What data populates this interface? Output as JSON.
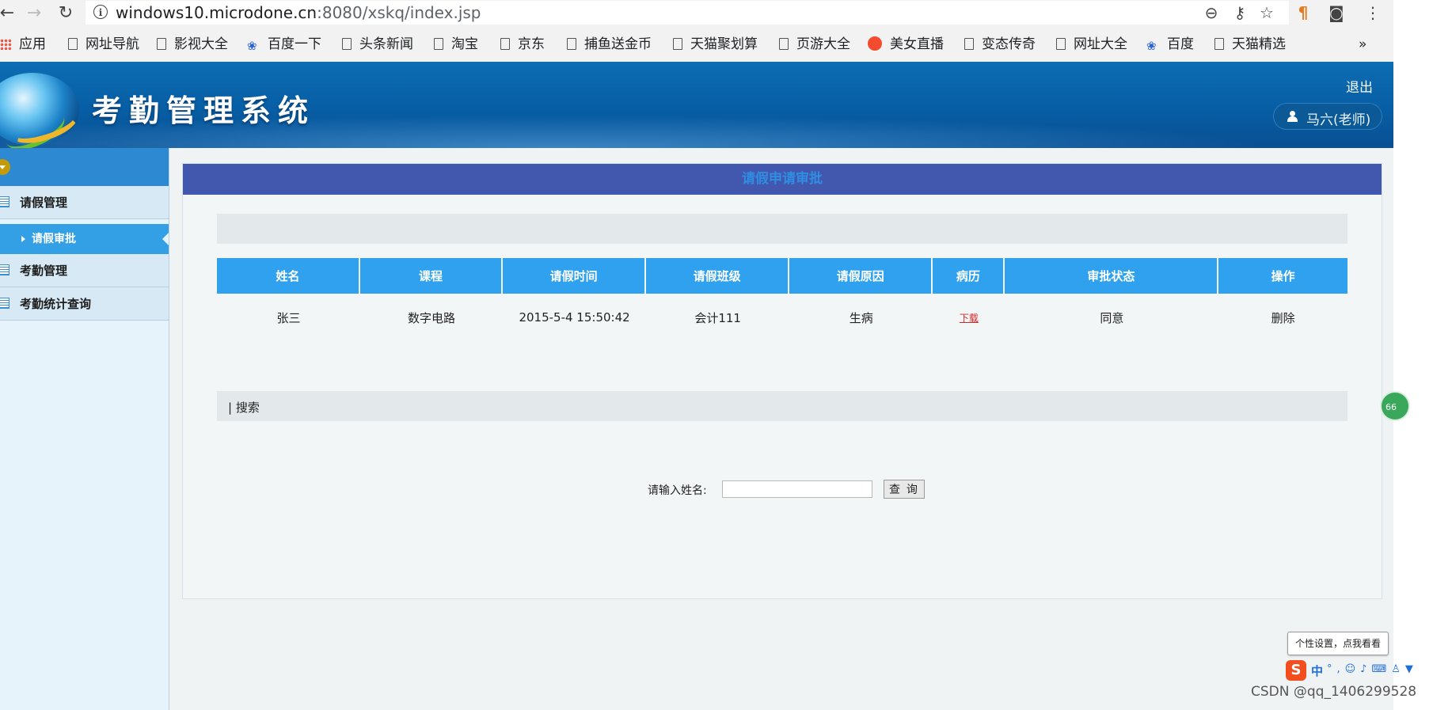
{
  "browser": {
    "url_host": "windows10.microdone.cn",
    "url_rest": ":8080/xskq/index.jsp",
    "bookmarks": [
      "应用",
      "网址导航",
      "影视大全",
      "百度一下",
      "头条新闻",
      "淘宝",
      "京东",
      "捕鱼送金币",
      "天猫聚划算",
      "页游大全",
      "美女直播",
      "变态传奇",
      "网址大全",
      "百度",
      "天猫精选"
    ],
    "more": "»"
  },
  "header": {
    "title": "考勤管理系统",
    "logout": "退出",
    "user": "马六(老师)"
  },
  "sidebar": {
    "items": [
      {
        "label": "请假管理"
      },
      {
        "label": "考勤管理"
      },
      {
        "label": "考勤统计查询"
      }
    ],
    "sub_active": "请假审批"
  },
  "panel": {
    "title": "请假申请审批",
    "table": {
      "headers": [
        "姓名",
        "课程",
        "请假时间",
        "请假班级",
        "请假原因",
        "病历",
        "审批状态",
        "操作"
      ],
      "rows": [
        {
          "name": "张三",
          "course": "数字电路",
          "time": "2015-5-4 15:50:42",
          "class": "会计111",
          "reason": "生病",
          "record": "下载",
          "status": "同意",
          "action": "删除"
        }
      ]
    },
    "search": {
      "section_label": "| 搜索",
      "field_label": "请输入姓名:",
      "value": "",
      "button": "查 询"
    }
  },
  "overlay": {
    "green_ball": "66",
    "tip": "个性设置，点我看看",
    "ime_logo": "S",
    "ime_mode": "中",
    "ime_icons": "°,☺♪⌨♙▼",
    "watermark": "CSDN @qq_1406299528"
  },
  "colors": {
    "banner": "#075ea4",
    "sidebar_active": "#339fe4",
    "table_header": "#2fa1ef",
    "panel_head": "#4257ae",
    "link": "#d02727"
  }
}
